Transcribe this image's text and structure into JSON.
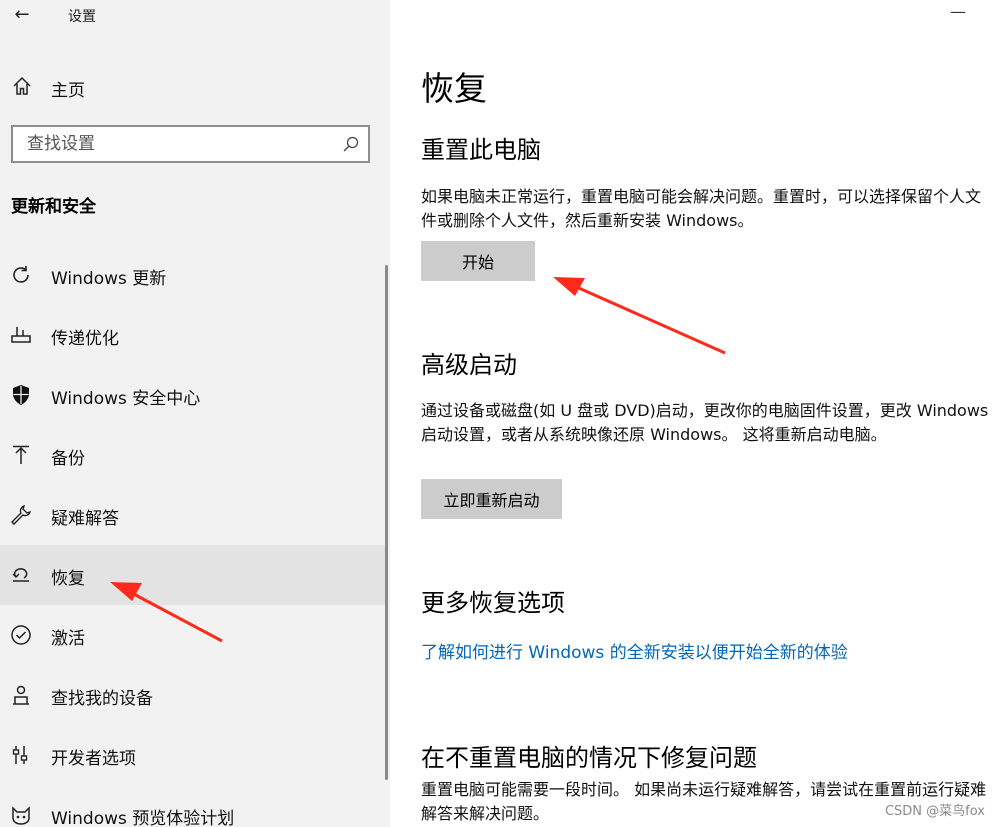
{
  "window": {
    "title": "设置",
    "back_glyph": "←",
    "minimize_glyph": "—"
  },
  "sidebar": {
    "home_label": "主页",
    "search_placeholder": "查找设置",
    "section_title": "更新和安全",
    "items": [
      {
        "label": "Windows 更新",
        "icon": "refresh-icon"
      },
      {
        "label": "传递优化",
        "icon": "delivery-icon"
      },
      {
        "label": "Windows 安全中心",
        "icon": "shield-icon"
      },
      {
        "label": "备份",
        "icon": "backup-icon"
      },
      {
        "label": "疑难解答",
        "icon": "wrench-icon"
      },
      {
        "label": "恢复",
        "icon": "recovery-icon",
        "selected": true
      },
      {
        "label": "激活",
        "icon": "check-circle-icon"
      },
      {
        "label": "查找我的设备",
        "icon": "find-device-icon"
      },
      {
        "label": "开发者选项",
        "icon": "developer-icon"
      },
      {
        "label": "Windows 预览体验计划",
        "icon": "insider-icon"
      }
    ]
  },
  "main": {
    "title": "恢复",
    "reset": {
      "heading": "重置此电脑",
      "description": "如果电脑未正常运行，重置电脑可能会解决问题。重置时，可以选择保留个人文件或删除个人文件，然后重新安装 Windows。",
      "button": "开始"
    },
    "advanced": {
      "heading": "高级启动",
      "description": "通过设备或磁盘(如 U 盘或 DVD)启动，更改你的电脑固件设置，更改 Windows 启动设置，或者从系统映像还原 Windows。 这将重新启动电脑。",
      "button": "立即重新启动"
    },
    "more": {
      "heading": "更多恢复选项",
      "link": "了解如何进行 Windows 的全新安装以便开始全新的体验"
    },
    "fix": {
      "heading": "在不重置电脑的情况下修复问题",
      "description": "重置电脑可能需要一段时间。 如果尚未运行疑难解答，请尝试在重置前运行疑难解答来解决问题。"
    }
  },
  "watermark": "CSDN @菜鸟fox",
  "colors": {
    "link": "#0067b8",
    "annotation_arrow": "#ff2a1a",
    "selected_bg": "#e3e3e3",
    "button_bg": "#cccccc"
  }
}
